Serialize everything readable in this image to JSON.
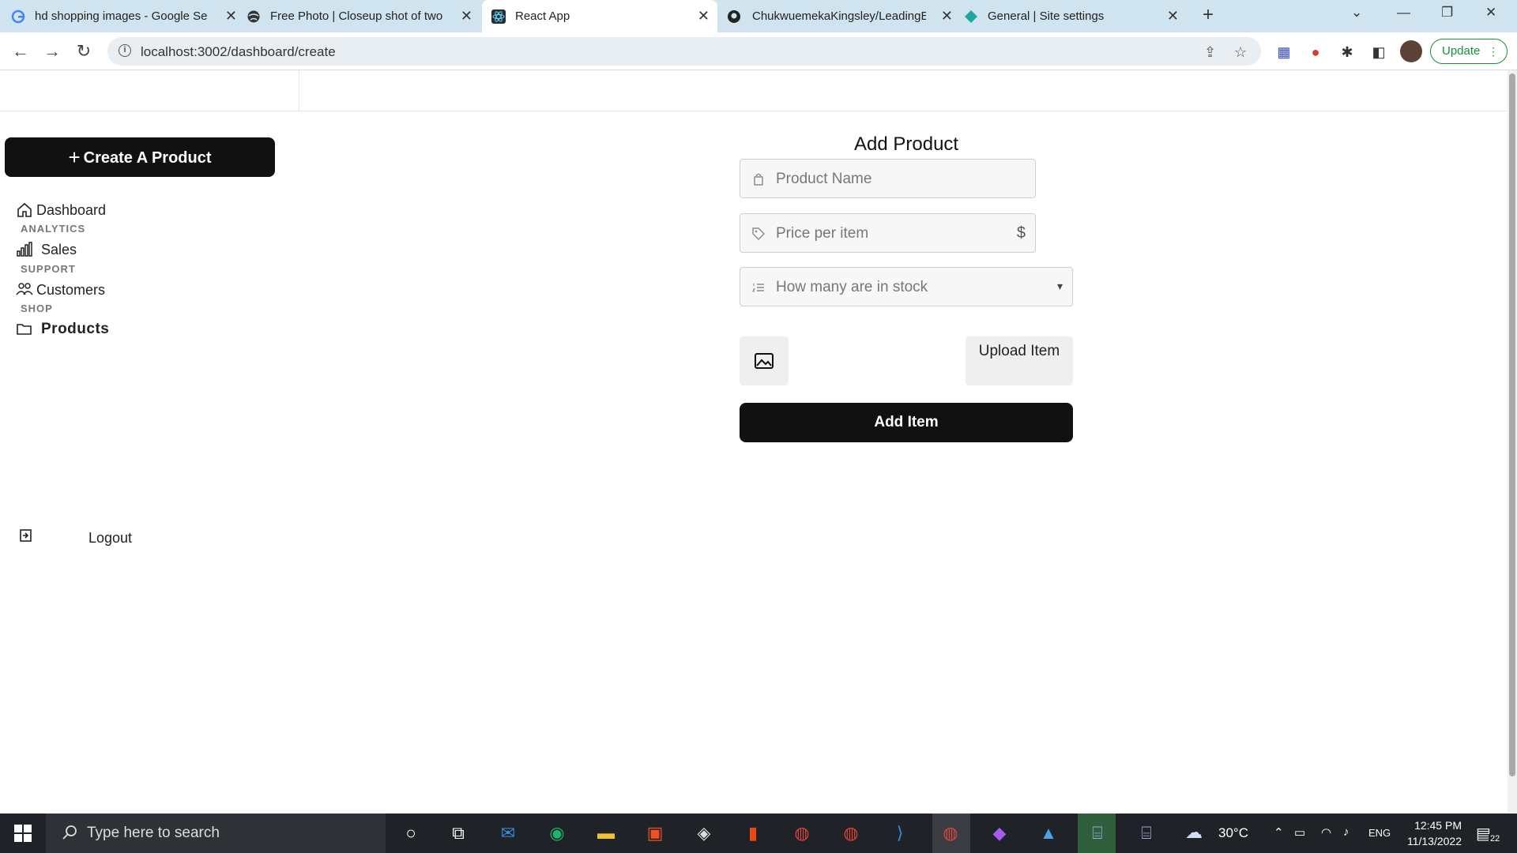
{
  "browser": {
    "tabs": [
      {
        "title": "hd shopping images - Google Se",
        "favicon": "google-icon",
        "active": false
      },
      {
        "title": "Free Photo | Closeup shot of two",
        "favicon": "globe-icon",
        "active": false
      },
      {
        "title": "React App",
        "favicon": "react-icon",
        "active": true
      },
      {
        "title": "ChukwuemekaKingsley/LeadingE",
        "favicon": "github-icon",
        "active": false
      },
      {
        "title": "General | Site settings",
        "favicon": "netlify-icon",
        "active": false
      }
    ],
    "new_tab_glyph": "+",
    "url": "localhost:3002/dashboard/create",
    "update_label": "Update",
    "accent": "#1a8f3a"
  },
  "sidebar": {
    "create_button_label": "Create A Product",
    "items": [
      {
        "label": "Dashboard",
        "icon": "home-icon"
      },
      {
        "label": "Sales",
        "icon": "bar-chart-icon"
      },
      {
        "label": "Customers",
        "icon": "users-icon"
      },
      {
        "label": "Products",
        "icon": "folder-icon"
      }
    ],
    "sections": [
      "ANALYTICS",
      "SUPPORT",
      "SHOP"
    ],
    "logout_label": "Logout"
  },
  "form": {
    "title": "Add Product",
    "product_name_placeholder": "Product Name",
    "price_placeholder": "Price per item",
    "price_suffix": "$",
    "stock_placeholder": "How many are in stock",
    "upload_label": "Upload Item",
    "submit_label": "Add Item"
  },
  "taskbar": {
    "search_placeholder": "Type here to search",
    "weather": "30°C",
    "language": "ENG",
    "time": "12:45 PM",
    "date": "11/13/2022",
    "notifications": "22"
  }
}
